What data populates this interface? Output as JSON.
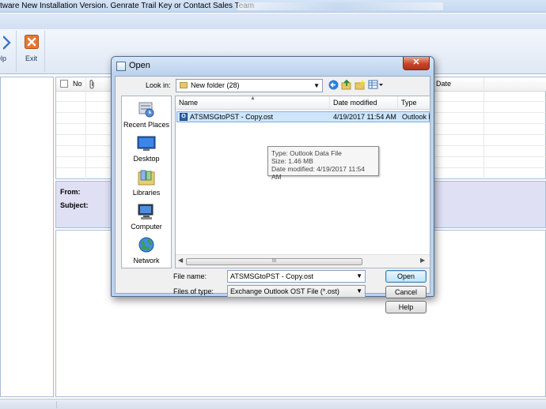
{
  "app": {
    "title": "tware New Installation Version. Genrate Trail Key or Contact Sales Team",
    "ribbon": {
      "help_label": "elp",
      "exit_label": "Exit"
    },
    "grid_headers": {
      "no": "No",
      "attach_icon": "paperclip",
      "date": "Date"
    },
    "preview": {
      "from_label": "From:",
      "subject_label": "Subject:"
    }
  },
  "dialog": {
    "title": "Open",
    "close_label": "✕",
    "look_in_label": "Look in:",
    "look_in_value": "New folder (28)",
    "places": [
      {
        "label": "Recent Places",
        "icon": "recent-places-icon"
      },
      {
        "label": "Desktop",
        "icon": "desktop-icon"
      },
      {
        "label": "Libraries",
        "icon": "libraries-icon"
      },
      {
        "label": "Computer",
        "icon": "computer-icon"
      },
      {
        "label": "Network",
        "icon": "network-icon"
      }
    ],
    "columns": {
      "name": "Name",
      "date_modified": "Date modified",
      "type": "Type"
    },
    "files": [
      {
        "name": "ATSMSGtoPST - Copy.ost",
        "date_modified": "4/19/2017 11:54 AM",
        "type": "Outlook D"
      }
    ],
    "tooltip": {
      "type": "Type: Outlook Data File",
      "size": "Size: 1.46 MB",
      "date": "Date modified: 4/19/2017 11:54 AM"
    },
    "file_name_label": "File name:",
    "file_name_value": "ATSMSGtoPST - Copy.ost",
    "files_of_type_label": "Files of type:",
    "files_of_type_value": "Exchange Outlook OST File (*.ost)",
    "buttons": {
      "open": "Open",
      "cancel": "Cancel",
      "help": "Help"
    },
    "scroll_thumb_grip": "III"
  },
  "colors": {
    "dialog_frame": "#bcd2ee",
    "selection": "#cde6fb",
    "close_button": "#c8452a",
    "exit_icon": "#e8772e"
  }
}
